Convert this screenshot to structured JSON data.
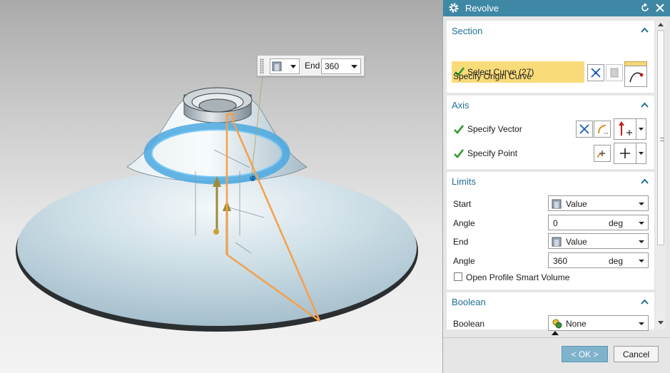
{
  "dialog": {
    "title": "Revolve",
    "section": {
      "heading": "Section",
      "select_curve": "Select Curve (27)",
      "specify_origin_curve": "Specify Origin Curve"
    },
    "axis": {
      "heading": "Axis",
      "specify_vector": "Specify Vector",
      "specify_point": "Specify Point"
    },
    "limits": {
      "heading": "Limits",
      "start_label": "Start",
      "start_type": "Value",
      "start_angle_label": "Angle",
      "start_angle_value": "0",
      "start_angle_unit": "deg",
      "end_label": "End",
      "end_type": "Value",
      "end_angle_label": "Angle",
      "end_angle_value": "360",
      "end_angle_unit": "deg",
      "open_profile_label": "Open Profile Smart Volume"
    },
    "boolean": {
      "heading": "Boolean",
      "label": "Boolean",
      "value": "None"
    },
    "ok_label": "< OK >",
    "cancel_label": "Cancel"
  },
  "floating_toolbar": {
    "end_label": "End",
    "end_value": "360"
  },
  "colors": {
    "titlebar": "#3f88a5",
    "heading": "#1f6f94",
    "selection": "#fadb7a",
    "profile_curve": "#f5a04a",
    "highlight_ring": "#4aa8e0",
    "check": "#2e9a2e"
  }
}
